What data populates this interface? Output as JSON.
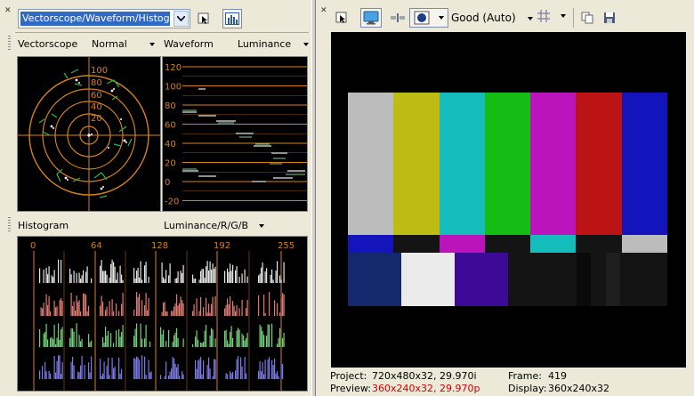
{
  "left_toolbar": {
    "scope_select_value": "Vectorscope/Waveform/Histogram",
    "icons": [
      "close-icon",
      "chevron-down-icon",
      "cursor-icon",
      "histogram-icon"
    ]
  },
  "vectorscope": {
    "title": "Vectorscope",
    "mode": "Normal",
    "rings": [
      "100",
      "80",
      "60",
      "40",
      "20"
    ]
  },
  "waveform": {
    "title": "Waveform",
    "mode": "Luminance",
    "ticks": [
      "120",
      "100",
      "80",
      "60",
      "40",
      "20",
      "0",
      "-20"
    ]
  },
  "histogram": {
    "title": "Histogram",
    "mode": "Luminance/R/G/B",
    "ticks": [
      "0",
      "64",
      "128",
      "192",
      "255"
    ]
  },
  "right_toolbar": {
    "quality": "Good (Auto)",
    "icons": [
      "close-icon",
      "cursor-icon",
      "monitor-icon",
      "split-icon",
      "overlay-icon",
      "grid-icon",
      "copy-icon",
      "save-icon"
    ]
  },
  "preview": {
    "colors": {
      "top_bars": [
        "#bcbcbc",
        "#bcbc14",
        "#14bcbc",
        "#14bc14",
        "#bc14bc",
        "#bc1414",
        "#1414bc"
      ],
      "mid_bars": [
        "#1414bc",
        "#141414",
        "#bc14bc",
        "#141414",
        "#14bcbc",
        "#141414",
        "#bcbcbc"
      ],
      "bottom_bars": [
        "#14286e",
        "#ebebeb",
        "#3c0a96",
        "#141414",
        "#141414",
        "#141414",
        "#141414"
      ]
    }
  },
  "status": {
    "project_label": "Project:",
    "project_value": "720x480x32, 29.970i",
    "preview_label": "Preview:",
    "preview_value": "360x240x32, 29.970p",
    "frame_label": "Frame:",
    "frame_value": "419",
    "display_label": "Display:",
    "display_value": "360x240x32",
    "preview_color": "#cc0000"
  }
}
